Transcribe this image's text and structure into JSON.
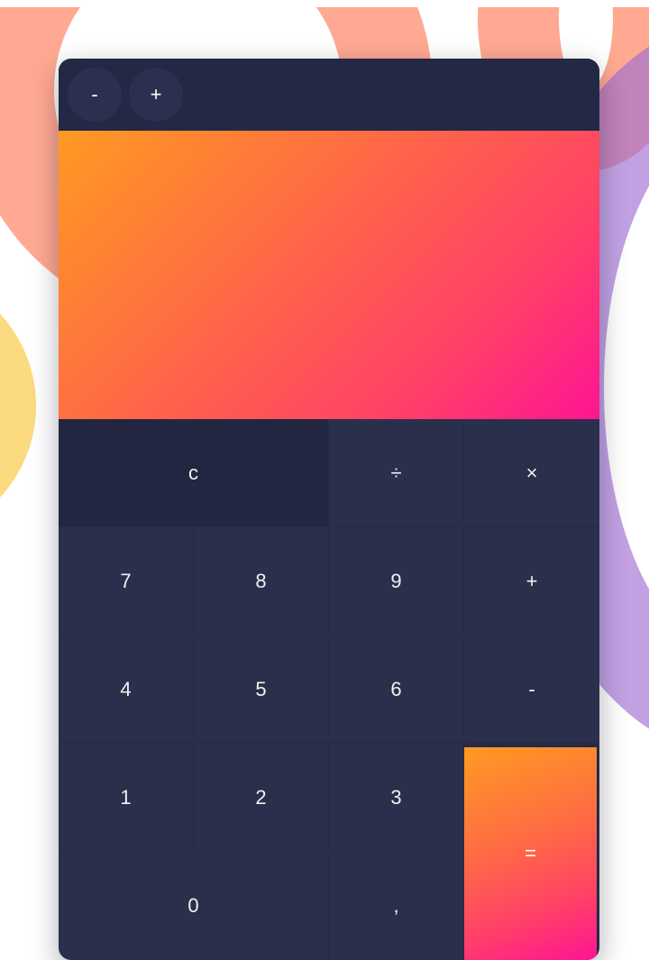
{
  "colors": {
    "panel": "#252a45",
    "key": "#2a2f4c",
    "accent_start": "#ff9a22",
    "accent_end": "#ff1493"
  },
  "size_controls": {
    "decrease_label": "-",
    "increase_label": "+"
  },
  "display": {
    "value": ""
  },
  "keys": {
    "clear": "c",
    "divide": "÷",
    "multiply": "×",
    "seven": "7",
    "eight": "8",
    "nine": "9",
    "add": "+",
    "four": "4",
    "five": "5",
    "six": "6",
    "subtract": "-",
    "one": "1",
    "two": "2",
    "three": "3",
    "equals": "=",
    "zero": "0",
    "decimal": ","
  }
}
